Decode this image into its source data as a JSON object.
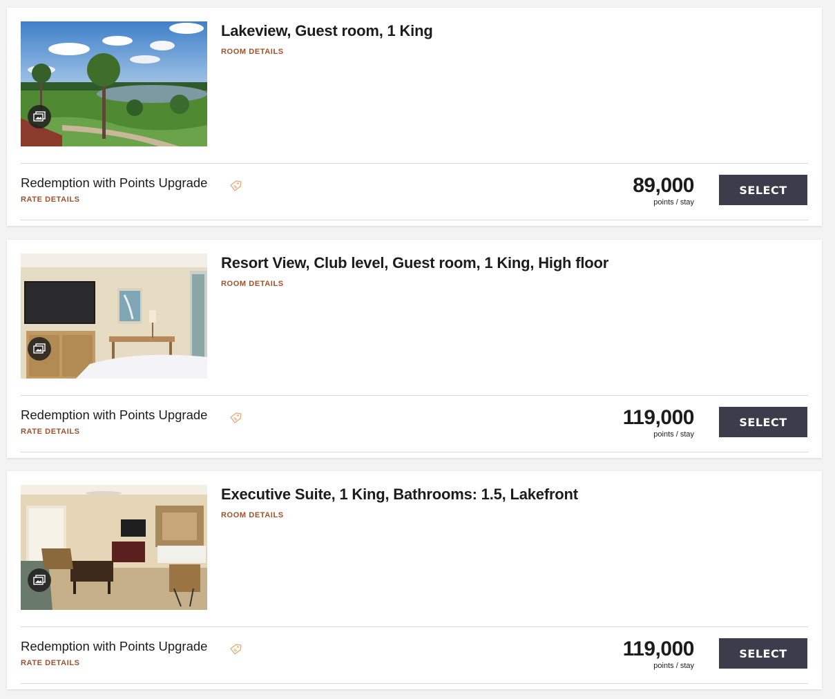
{
  "rooms": [
    {
      "title": "Lakeview, Guest room, 1 King",
      "room_details_label": "ROOM DETAILS",
      "rate_name": "Redemption with Points Upgrade",
      "rate_details_label": "RATE DETAILS",
      "price": "89,000",
      "price_unit": "points / stay",
      "select_label": "SELECT"
    },
    {
      "title": "Resort View, Club level, Guest room, 1 King, High floor",
      "room_details_label": "ROOM DETAILS",
      "rate_name": "Redemption with Points Upgrade",
      "rate_details_label": "RATE DETAILS",
      "price": "119,000",
      "price_unit": "points / stay",
      "select_label": "SELECT"
    },
    {
      "title": "Executive Suite, 1 King, Bathrooms: 1.5, Lakefront",
      "room_details_label": "ROOM DETAILS",
      "rate_name": "Redemption with Points Upgrade",
      "rate_details_label": "RATE DETAILS",
      "price": "119,000",
      "price_unit": "points / stay",
      "select_label": "SELECT"
    }
  ],
  "colors": {
    "link": "#a0502a",
    "button": "#3d3c4c",
    "tag_icon": "#e8a878"
  },
  "icons": {
    "gallery": "gallery-icon",
    "tag": "tag-icon"
  }
}
